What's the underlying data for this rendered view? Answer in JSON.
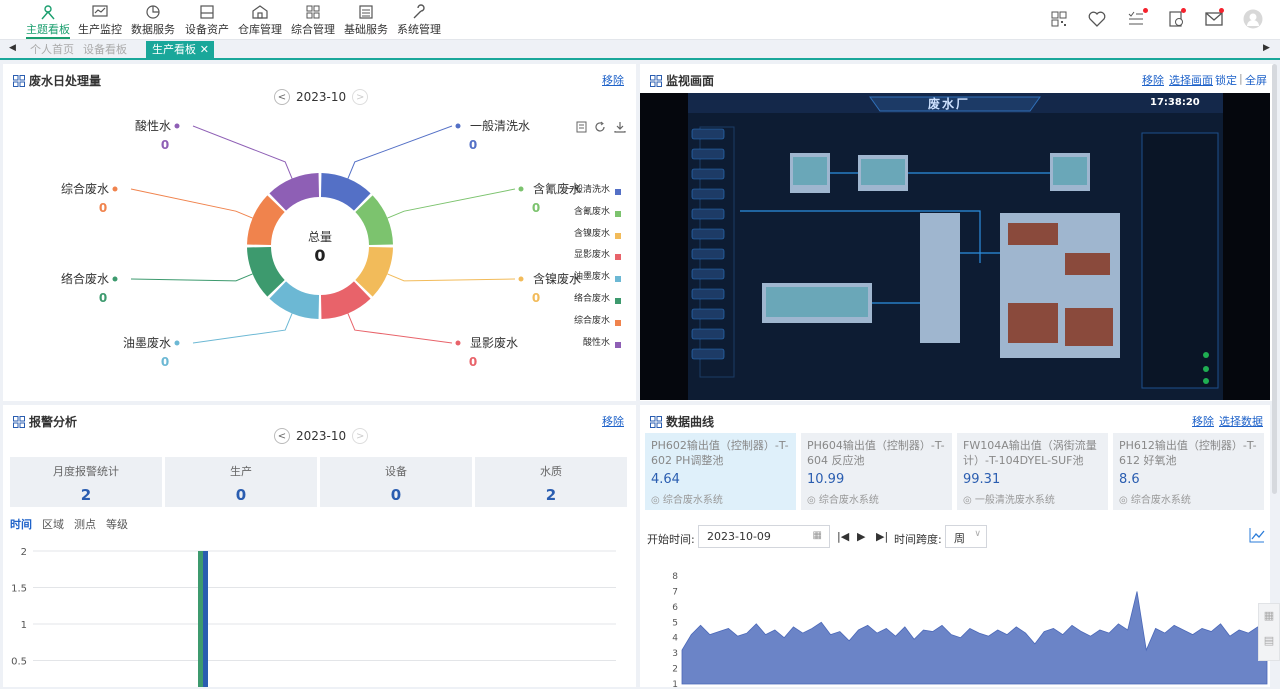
{
  "nav": {
    "items": [
      {
        "label": "主题看板",
        "icon": "person-network-icon",
        "active": true
      },
      {
        "label": "生产监控",
        "icon": "monitor-chart-icon"
      },
      {
        "label": "数据服务",
        "icon": "pie-icon"
      },
      {
        "label": "设备资产",
        "icon": "device-icon"
      },
      {
        "label": "仓库管理",
        "icon": "warehouse-icon"
      },
      {
        "label": "综合管理",
        "icon": "grid-icon"
      },
      {
        "label": "基础服务",
        "icon": "list-icon"
      },
      {
        "label": "系统管理",
        "icon": "wrench-icon"
      }
    ]
  },
  "tabs": [
    "个人首页",
    "设备看板",
    "生产看板"
  ],
  "colors": {
    "accent": "#1aa79a",
    "link": "#1e62c9",
    "value": "#2a5db0"
  },
  "wastewater": {
    "title": "废水日处理量",
    "remove": "移除",
    "date": "2023-10",
    "center_label": "总量",
    "center_value": "0",
    "segments": [
      {
        "name": "一般清洗水",
        "value": "0",
        "color": "#5470c6"
      },
      {
        "name": "含氰废水",
        "value": "0",
        "color": "#7cc36e"
      },
      {
        "name": "含镍废水",
        "value": "0",
        "color": "#f2bb5a"
      },
      {
        "name": "显影废水",
        "value": "0",
        "color": "#e8636a"
      },
      {
        "name": "油墨废水",
        "value": "0",
        "color": "#6cb8d4"
      },
      {
        "name": "络合废水",
        "value": "0",
        "color": "#3d9a6e"
      },
      {
        "name": "综合废水",
        "value": "0",
        "color": "#f0834d"
      },
      {
        "name": "酸性水",
        "value": "0",
        "color": "#8e5fb5"
      }
    ],
    "legend": [
      "一般清洗水",
      "含氰废水",
      "含镍废水",
      "显影废水",
      "油墨废水",
      "络合废水",
      "综合废水",
      "酸性水"
    ]
  },
  "monitor": {
    "title": "监视画面",
    "links": [
      "移除",
      "选择画面",
      "锁定",
      "全屏"
    ],
    "plant_title": "废水厂",
    "clock": "17:38:20"
  },
  "alarm": {
    "title": "报警分析",
    "remove": "移除",
    "date": "2023-10",
    "stats": [
      {
        "label": "月度报警统计",
        "value": "2"
      },
      {
        "label": "生产",
        "value": "0"
      },
      {
        "label": "设备",
        "value": "0"
      },
      {
        "label": "水质",
        "value": "2"
      }
    ],
    "subtabs": [
      "时间",
      "区域",
      "测点",
      "等级"
    ],
    "ticks": [
      "2",
      "1.5",
      "1",
      "0.5"
    ]
  },
  "curves": {
    "title": "数据曲线",
    "links": [
      "移除",
      "选择数据"
    ],
    "cards": [
      {
        "title": "PH602输出值（控制器）-T-602 PH调整池",
        "value": "4.64",
        "system": "综合废水系统"
      },
      {
        "title": "PH604输出值（控制器）-T-604 反应池",
        "value": "10.99",
        "system": "综合废水系统"
      },
      {
        "title": "FW104A输出值（涡街流量计）-T-104DYEL-SUF池",
        "value": "99.31",
        "system": "一般清洗废水系统"
      },
      {
        "title": "PH612输出值（控制器）-T-612 好氧池",
        "value": "8.6",
        "system": "综合废水系统"
      }
    ],
    "start_label": "开始时间:",
    "start_date": "2023-10-09",
    "span_label": "时间跨度:",
    "span_value": "周",
    "yticks": [
      "8",
      "7",
      "6",
      "5",
      "4",
      "3",
      "2",
      "1"
    ]
  },
  "chart_data": [
    {
      "type": "pie",
      "title": "废水日处理量",
      "categories": [
        "一般清洗水",
        "含氰废水",
        "含镍废水",
        "显影废水",
        "油墨废水",
        "络合废水",
        "综合废水",
        "酸性水"
      ],
      "values": [
        0,
        0,
        0,
        0,
        0,
        0,
        0,
        0
      ]
    },
    {
      "type": "bar",
      "title": "报警分析",
      "ylim": [
        0,
        2
      ],
      "series": [
        {
          "values": [
            2
          ]
        }
      ]
    },
    {
      "type": "area",
      "title": "数据曲线",
      "ylim": [
        1,
        8
      ],
      "series": [
        {
          "values": [
            3.2,
            4.2,
            4.8,
            4.2,
            4.4,
            4.6,
            4.1,
            4.3,
            4.9,
            4.2,
            4.5,
            4.0,
            4.7,
            4.3,
            4.6,
            5.0,
            4.2,
            4.4,
            3.8,
            4.5,
            4.8,
            4.3,
            4.6,
            4.1,
            4.7,
            3.9,
            4.5,
            4.4,
            4.8,
            4.2,
            4.0,
            4.6,
            4.3,
            4.1,
            4.5,
            4.2,
            4.7,
            4.3,
            3.6,
            4.4,
            4.6,
            4.2,
            4.8,
            4.4,
            4.1,
            4.5,
            4.3,
            4.9,
            4.5,
            7.0,
            3.2,
            4.6,
            4.3,
            4.8,
            4.5,
            4.2,
            4.6,
            4.4,
            4.9,
            4.1,
            4.5,
            4.3,
            4.7,
            4.6
          ]
        }
      ]
    }
  ]
}
